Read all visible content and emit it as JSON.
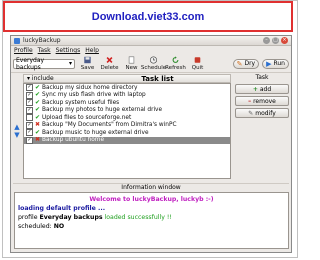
{
  "banner": {
    "text": "Download.viet33.com"
  },
  "window": {
    "title": "luckyBackup"
  },
  "menu": [
    "Profile",
    "Task",
    "Settings",
    "Help"
  ],
  "toolbar": {
    "profile": "Everyday backups",
    "buttons": [
      "Save",
      "Delete",
      "New",
      "Schedule",
      "Refresh",
      "Quit"
    ],
    "dry": "Dry",
    "run": "Run"
  },
  "tasklist": {
    "col_include": "include",
    "title": "Task list",
    "tasks": [
      {
        "name": "Backup my sidux home directory",
        "checked": true,
        "ok": true
      },
      {
        "name": "Sync my usb flash drive with laptop",
        "checked": true,
        "ok": true
      },
      {
        "name": "Backup system useful files",
        "checked": true,
        "ok": true
      },
      {
        "name": "Backup my photos to huge external drive",
        "checked": true,
        "ok": true
      },
      {
        "name": "Upload files to sourceforge.net",
        "checked": false,
        "ok": true
      },
      {
        "name": "Backup \"My Documents\" from Dimitra's winPC",
        "checked": true,
        "ok": false
      },
      {
        "name": "Backup music to huge external drive",
        "checked": true,
        "ok": true
      },
      {
        "name": "Backup ubuntu home",
        "checked": true,
        "ok": false
      }
    ]
  },
  "task_panel": {
    "label": "Task",
    "add": "add",
    "remove": "remove",
    "modify": "modify"
  },
  "info": {
    "header": "Information window",
    "welcome": "Welcome to luckyBackup, luckyb :-)",
    "loading": "loading default profile ...",
    "profile_prefix": "profile",
    "profile_name": "Everyday backups",
    "profile_suffix": "loaded successfully !!",
    "scheduled_label": "scheduled:",
    "scheduled_value": "NO"
  }
}
